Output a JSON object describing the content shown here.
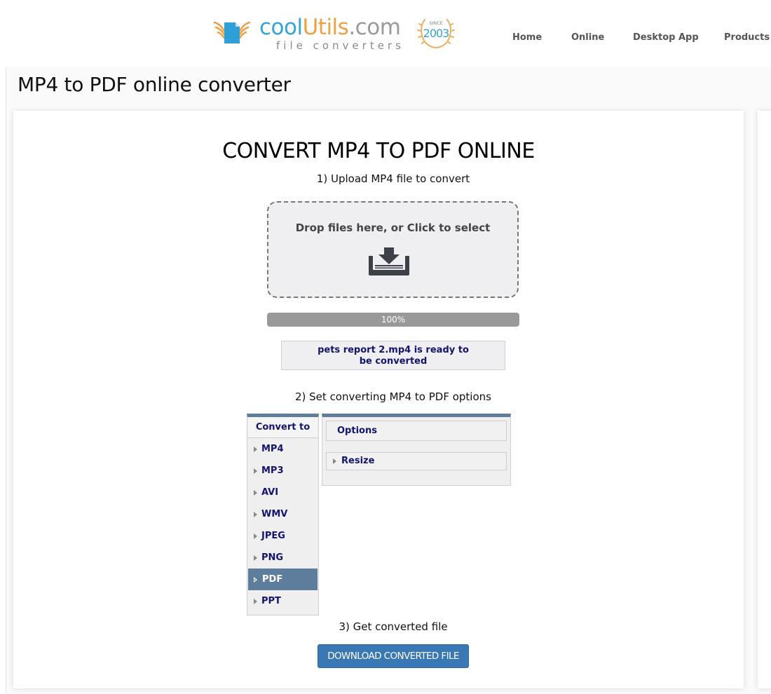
{
  "header": {
    "logo": {
      "brand_part1": "cool",
      "brand_part2": "Utils",
      "brand_part3": ".com",
      "tagline": "file converters",
      "badge_top": "SINCE",
      "badge_year": "2003"
    },
    "nav": [
      {
        "label": "Home"
      },
      {
        "label": "Online"
      },
      {
        "label": "Desktop App"
      },
      {
        "label": "Products"
      }
    ]
  },
  "page": {
    "title": "MP4 to PDF online converter"
  },
  "converter": {
    "heading": "CONVERT MP4 TO PDF ONLINE",
    "step1": "1) Upload MP4 file to convert",
    "dropzone_label": "Drop files here, or Click to select",
    "progress": {
      "percent": 100,
      "label": "100%"
    },
    "status_message": "pets report 2.mp4 is ready to be converted",
    "step2": "2) Set converting MP4 to PDF options",
    "convert_to": {
      "header": "Convert to",
      "formats": [
        "MP4",
        "MP3",
        "AVI",
        "WMV",
        "JPEG",
        "PNG",
        "PDF",
        "PPT"
      ],
      "selected": "PDF"
    },
    "options": {
      "header": "Options",
      "sections": [
        "Resize"
      ]
    },
    "step3": "3) Get converted file",
    "download_label": "DOWNLOAD CONVERTED FILE"
  },
  "colors": {
    "accent_blue": "#3a77b5",
    "selected_item": "#5e7d9d",
    "text_navy": "#14146e",
    "logo_blue": "#35a4da",
    "logo_orange": "#f0a044"
  }
}
